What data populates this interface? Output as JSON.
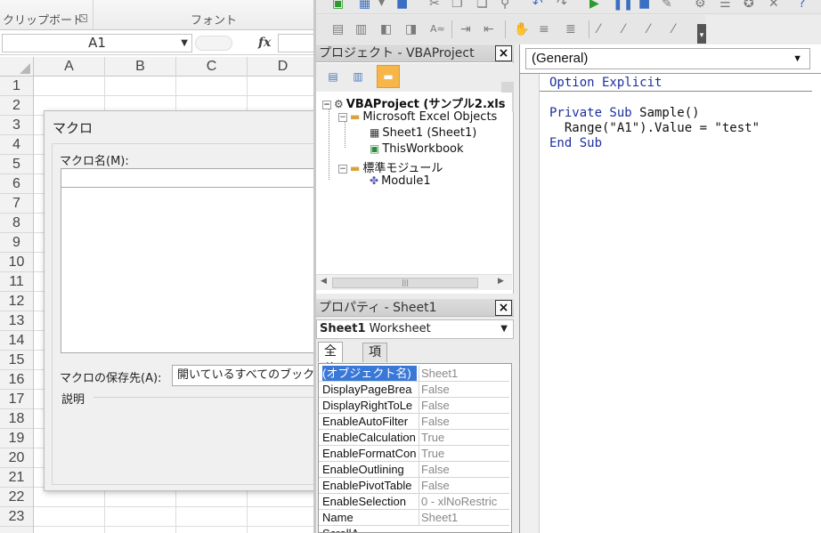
{
  "excel": {
    "ribbon": {
      "clipboard_label": "クリップボード",
      "font_label": "フォント"
    },
    "name_box": "A1",
    "fx_label": "fx",
    "columns": [
      "A",
      "B",
      "C",
      "D"
    ],
    "rows": [
      "1",
      "2",
      "3",
      "4",
      "5",
      "6",
      "7",
      "8",
      "9",
      "10",
      "11",
      "12",
      "13",
      "14",
      "15",
      "16",
      "17",
      "18",
      "19",
      "20",
      "21",
      "22",
      "23"
    ],
    "macro_dialog": {
      "title": "マクロ",
      "name_label": "マクロ名(M):",
      "location_label": "マクロの保存先(A):",
      "location_value": "開いているすべてのブック",
      "description_label": "説明"
    }
  },
  "vbe": {
    "project": {
      "title": "プロジェクト - VBAProject",
      "close": "×",
      "tree": {
        "project": "VBAProject (サンプル2.xls",
        "excel_objects": "Microsoft Excel Objects",
        "sheet1": "Sheet1 (Sheet1)",
        "thisworkbook": "ThisWorkbook",
        "std_modules": "標準モジュール",
        "module1": "Module1"
      }
    },
    "properties": {
      "title": "プロパティ - Sheet1",
      "close": "×",
      "object_name": "Sheet1",
      "object_type": "Worksheet",
      "tab_all": "全体",
      "tab_category": "項目別",
      "rows": [
        {
          "name": "(オブジェクト名)",
          "value": "Sheet1"
        },
        {
          "name": "DisplayPageBrea",
          "value": "False"
        },
        {
          "name": "DisplayRightToLe",
          "value": "False"
        },
        {
          "name": "EnableAutoFilter",
          "value": "False"
        },
        {
          "name": "EnableCalculation",
          "value": "True"
        },
        {
          "name": "EnableFormatCon",
          "value": "True"
        },
        {
          "name": "EnableOutlining",
          "value": "False"
        },
        {
          "name": "EnablePivotTable",
          "value": "False"
        },
        {
          "name": "EnableSelection",
          "value": "0 - xlNoRestric"
        },
        {
          "name": "Name",
          "value": "Sheet1"
        },
        {
          "name": "ScrollA",
          "value": ""
        }
      ]
    },
    "code": {
      "combo": "(General)",
      "lines": {
        "l1_kw": "Option Explicit",
        "l2_kw": "Private Sub",
        "l2_rest": " Sample()",
        "l3": "  Range(\"A1\").Value = \"test\"",
        "l4_kw": "End Sub"
      }
    }
  }
}
